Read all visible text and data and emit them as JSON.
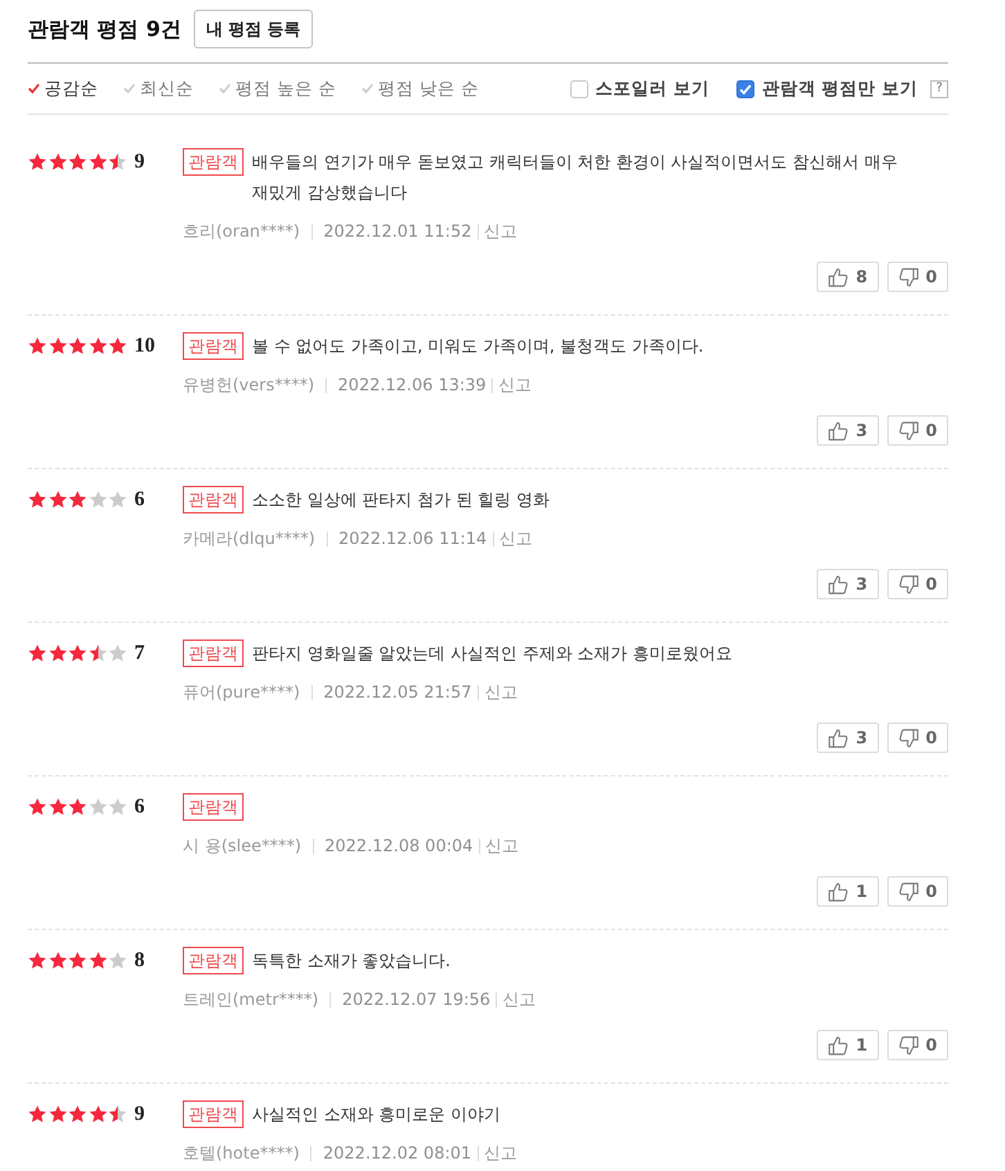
{
  "header": {
    "title": "관람객 평점 9건",
    "register_button": "내 평점 등록"
  },
  "sort_options": [
    {
      "label": "공감순",
      "selected": true
    },
    {
      "label": "최신순",
      "selected": false
    },
    {
      "label": "평점 높은 순",
      "selected": false
    },
    {
      "label": "평점 낮은 순",
      "selected": false
    }
  ],
  "filters": [
    {
      "label": "스포일러 보기",
      "checked": false
    },
    {
      "label": "관람객 평점만 보기",
      "checked": true
    }
  ],
  "help": "?",
  "reviews": [
    {
      "stars": 4.5,
      "score": "9",
      "badge": "관람객",
      "text": "배우들의 연기가 매우 돋보였고 캐릭터들이 처한 환경이 사실적이면서도 참신해서 매우 재밌게 감상했습니다",
      "author": "흐리(oran****)",
      "date": "2022.12.01 11:52",
      "report": "신고",
      "likes": "8",
      "dislikes": "0"
    },
    {
      "stars": 5,
      "score": "10",
      "badge": "관람객",
      "text": "볼 수 없어도 가족이고, 미워도 가족이며, 불청객도 가족이다.",
      "author": "유병헌(vers****)",
      "date": "2022.12.06 13:39",
      "report": "신고",
      "likes": "3",
      "dislikes": "0"
    },
    {
      "stars": 3,
      "score": "6",
      "badge": "관람객",
      "text": "소소한 일상에 판타지 첨가 된 힐링 영화",
      "author": "카메라(dlqu****)",
      "date": "2022.12.06 11:14",
      "report": "신고",
      "likes": "3",
      "dislikes": "0"
    },
    {
      "stars": 3.5,
      "score": "7",
      "badge": "관람객",
      "text": "판타지 영화일줄 알았는데 사실적인 주제와 소재가 흥미로웠어요",
      "author": "퓨어(pure****)",
      "date": "2022.12.05 21:57",
      "report": "신고",
      "likes": "3",
      "dislikes": "0"
    },
    {
      "stars": 3,
      "score": "6",
      "badge": "관람객",
      "author": "시 용(slee****)",
      "date": "2022.12.08 00:04",
      "report": "신고",
      "likes": "1",
      "dislikes": "0"
    },
    {
      "stars": 4,
      "score": "8",
      "badge": "관람객",
      "text": "독특한 소재가 좋았습니다.",
      "author": "트레인(metr****)",
      "date": "2022.12.07 19:56",
      "report": "신고",
      "likes": "1",
      "dislikes": "0"
    },
    {
      "stars": 4.5,
      "score": "9",
      "badge": "관람객",
      "text": "사실적인 소재와 흥미로운 이야기",
      "author": "호텔(hote****)",
      "date": "2022.12.02 08:01",
      "report": "신고"
    }
  ]
}
